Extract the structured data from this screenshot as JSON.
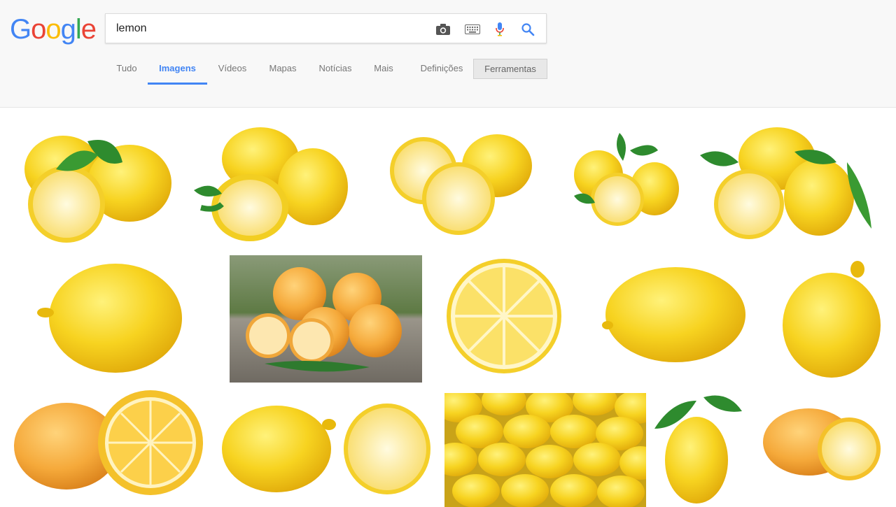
{
  "logo": {
    "letters": [
      "G",
      "o",
      "o",
      "g",
      "l",
      "e"
    ],
    "colors": [
      "#4285f4",
      "#ea4335",
      "#fbbc05",
      "#4285f4",
      "#34a853",
      "#ea4335"
    ]
  },
  "search": {
    "value": "lemon"
  },
  "icons": {
    "camera": "camera-icon",
    "keyboard": "keyboard-icon",
    "mic": "microphone-icon",
    "search": "search-icon"
  },
  "tabs": [
    {
      "label": "Tudo"
    },
    {
      "label": "Imagens"
    },
    {
      "label": "Vídeos"
    },
    {
      "label": "Mapas"
    },
    {
      "label": "Notícias"
    },
    {
      "label": "Mais"
    },
    {
      "label": "Definições"
    }
  ],
  "active_tab": "Imagens",
  "tools_button": "Ferramentas",
  "colors": {
    "accent": "#4285f4",
    "lemon": "#f5d31a",
    "lemon_dark": "#e8b90c",
    "pulp": "#fbe48a",
    "leaf": "#2e8b2e"
  }
}
